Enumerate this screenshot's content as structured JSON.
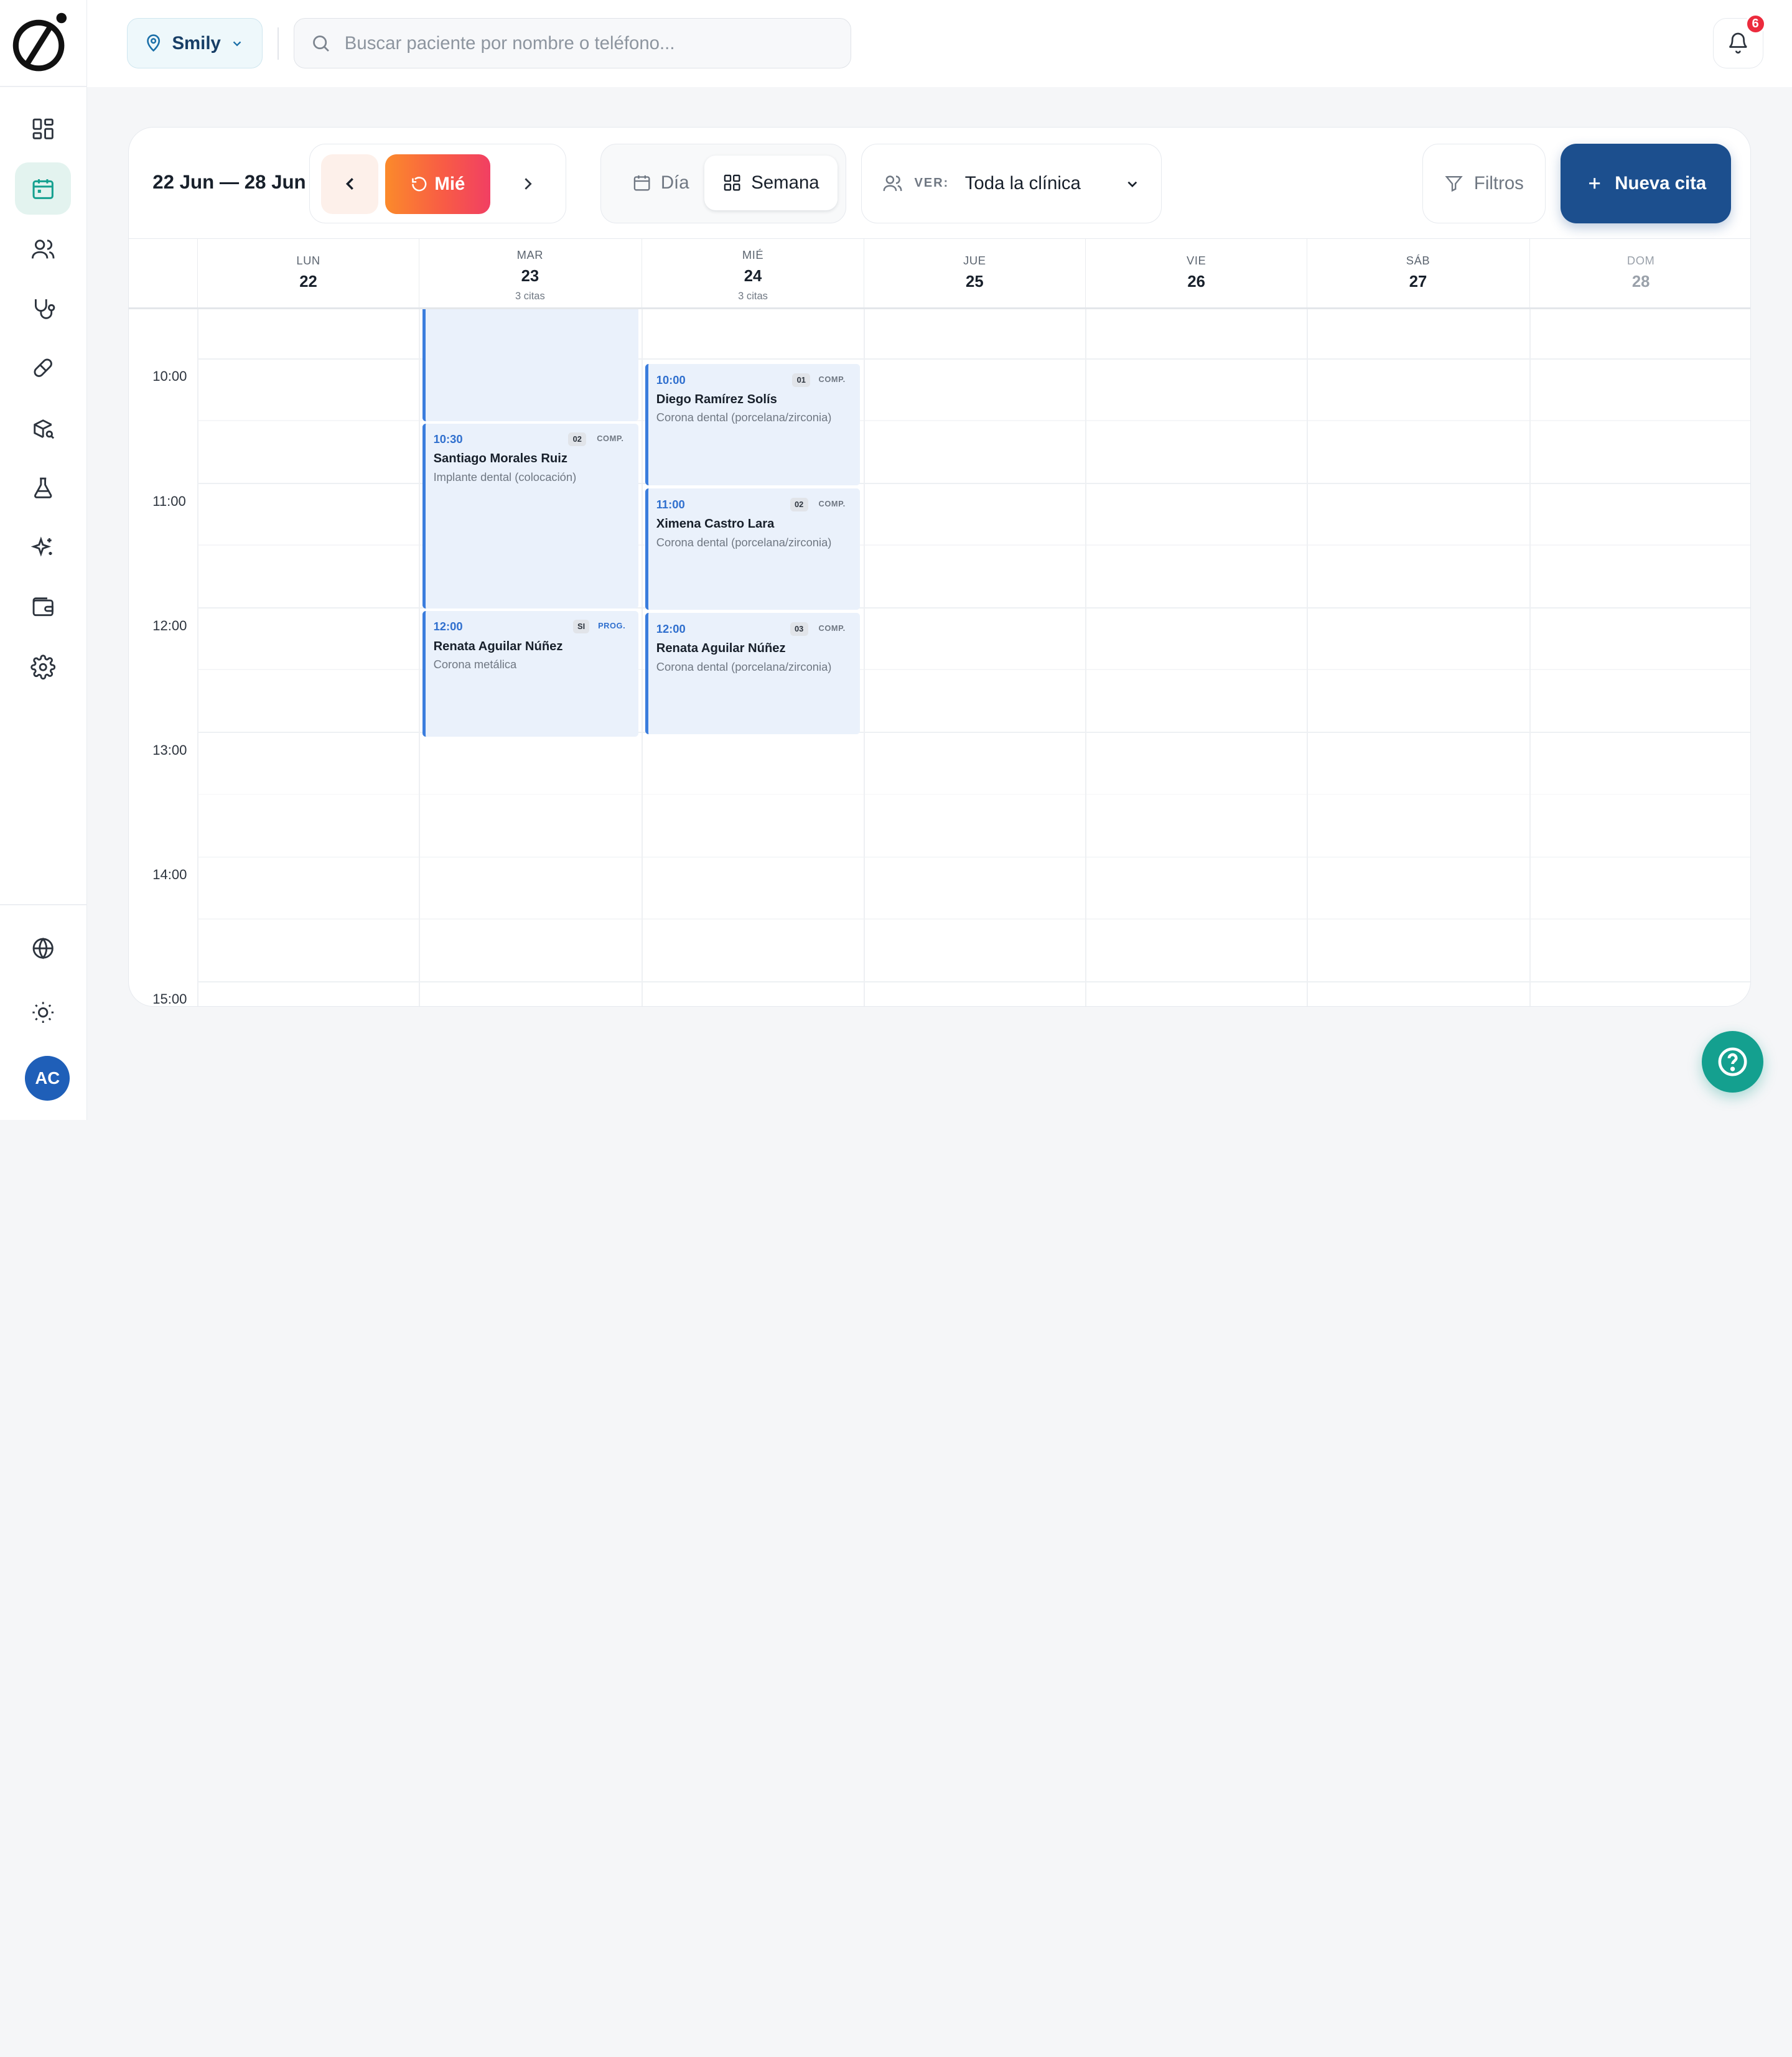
{
  "header": {
    "clinic": "Smily",
    "search_placeholder": "Buscar paciente por nombre o teléfono...",
    "notifications_count": "6"
  },
  "sidebar": {
    "items": [
      {
        "name": "dashboard",
        "icon": "dashboard-icon",
        "active": false
      },
      {
        "name": "calendar",
        "icon": "calendar-icon",
        "active": true
      },
      {
        "name": "patients",
        "icon": "users-icon",
        "active": false
      },
      {
        "name": "stethoscope",
        "icon": "stethoscope-icon",
        "active": false
      },
      {
        "name": "pill",
        "icon": "pill-icon",
        "active": false
      },
      {
        "name": "inventory",
        "icon": "package-search-icon",
        "active": false
      },
      {
        "name": "lab",
        "icon": "flask-icon",
        "active": false
      },
      {
        "name": "ai",
        "icon": "sparkles-icon",
        "active": false
      },
      {
        "name": "wallet",
        "icon": "wallet-icon",
        "active": false
      },
      {
        "name": "settings",
        "icon": "gear-icon",
        "active": false
      }
    ],
    "bottom": [
      {
        "name": "language",
        "icon": "globe-icon"
      },
      {
        "name": "theme",
        "icon": "sun-icon"
      }
    ],
    "avatar_initials": "AC"
  },
  "toolbar": {
    "range": "22 Jun — 28 Jun",
    "today_label": "Mié",
    "view_day": "Día",
    "view_week": "Semana",
    "ver_label": "VER:",
    "ver_value": "Toda la clínica",
    "filters": "Filtros",
    "new_appointment": "Nueva cita"
  },
  "week": {
    "days": [
      {
        "dow": "LUN",
        "dom": "22",
        "count": ""
      },
      {
        "dow": "MAR",
        "dom": "23",
        "count": "3 citas"
      },
      {
        "dow": "MIÉ",
        "dom": "24",
        "count": "3 citas"
      },
      {
        "dow": "JUE",
        "dom": "25",
        "count": ""
      },
      {
        "dow": "VIE",
        "dom": "26",
        "count": ""
      },
      {
        "dow": "SÁB",
        "dom": "27",
        "count": ""
      },
      {
        "dow": "DOM",
        "dom": "28",
        "count": ""
      }
    ],
    "hours": [
      "10:00",
      "11:00",
      "12:00",
      "13:00",
      "14:00",
      "15:00"
    ]
  },
  "events": [
    {
      "day": 1,
      "start": "09:00",
      "end": "10:30",
      "time": "",
      "room": "",
      "status": "",
      "name": "",
      "procedure": ""
    },
    {
      "day": 1,
      "start": "10:30",
      "end": "12:00",
      "time": "10:30",
      "room": "02",
      "status": "COMP.",
      "name": "Santiago Morales Ruiz",
      "procedure": "Implante dental (colocación)"
    },
    {
      "day": 1,
      "start": "12:00",
      "end": "13:00",
      "time": "12:00",
      "room": "SI",
      "status": "PROG.",
      "name": "Renata Aguilar Núñez",
      "procedure": "Corona metálica"
    },
    {
      "day": 2,
      "start": "10:00",
      "end": "11:00",
      "time": "10:00",
      "room": "01",
      "status": "COMP.",
      "name": "Diego Ramírez Solís",
      "procedure": "Corona dental (porcelana/zirconia)"
    },
    {
      "day": 2,
      "start": "11:00",
      "end": "12:00",
      "time": "11:00",
      "room": "02",
      "status": "COMP.",
      "name": "Ximena Castro Lara",
      "procedure": "Corona dental (porcelana/zirconia)"
    },
    {
      "day": 2,
      "start": "12:00",
      "end": "13:00",
      "time": "12:00",
      "room": "03",
      "status": "COMP.",
      "name": "Renata Aguilar Núñez",
      "procedure": "Corona dental (porcelana/zirconia)"
    }
  ],
  "colors": {
    "accent": "#1c4f8e",
    "today_gradient_start": "#fb8a2b",
    "today_gradient_end": "#f13f63",
    "event_bg": "#eaf1fb",
    "event_border": "#3b7ddd",
    "help": "#14a08f",
    "badge": "#ec2b3d"
  }
}
